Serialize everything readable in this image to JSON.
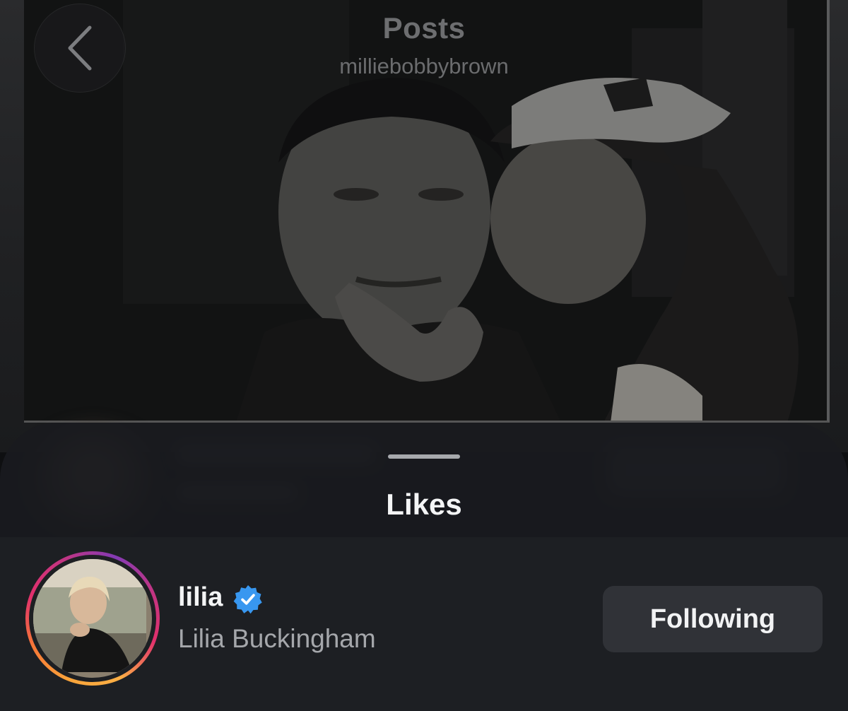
{
  "header": {
    "title": "Posts",
    "subtitle": "milliebobbybrown"
  },
  "icons": {
    "back": "chevron-left-icon",
    "verified": "verified-badge-icon"
  },
  "sheet": {
    "title": "Likes"
  },
  "likes": [
    {
      "username": "lilia",
      "full_name": "Lilia Buckingham",
      "verified": true,
      "follow_status": "Following"
    }
  ],
  "colors": {
    "verified_badge": "#3897f0",
    "sheet_bg": "#1d1f23",
    "button_bg": "#303237"
  }
}
